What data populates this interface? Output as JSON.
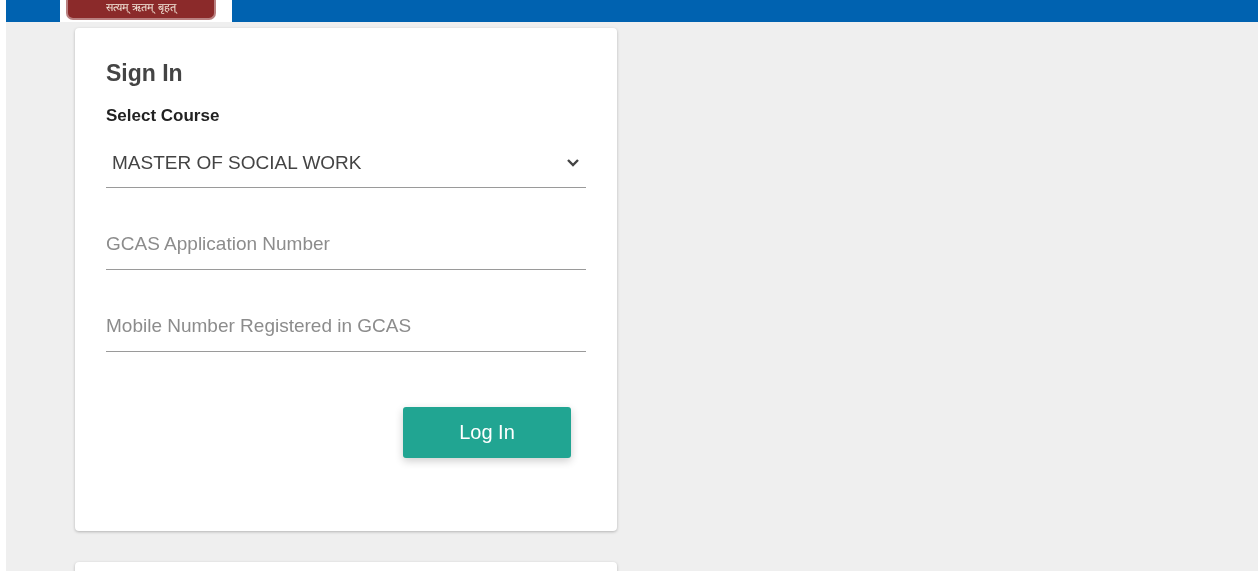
{
  "header": {
    "motto": "सत्यम् ऋतम् बृहत्"
  },
  "sign_in": {
    "title": "Sign In",
    "course_label": "Select Course",
    "course_value": "MASTER OF SOCIAL WORK",
    "fields": [
      {
        "placeholder": "GCAS Application Number"
      },
      {
        "placeholder": "Mobile Number Registered in GCAS"
      }
    ],
    "button": "Log In"
  }
}
